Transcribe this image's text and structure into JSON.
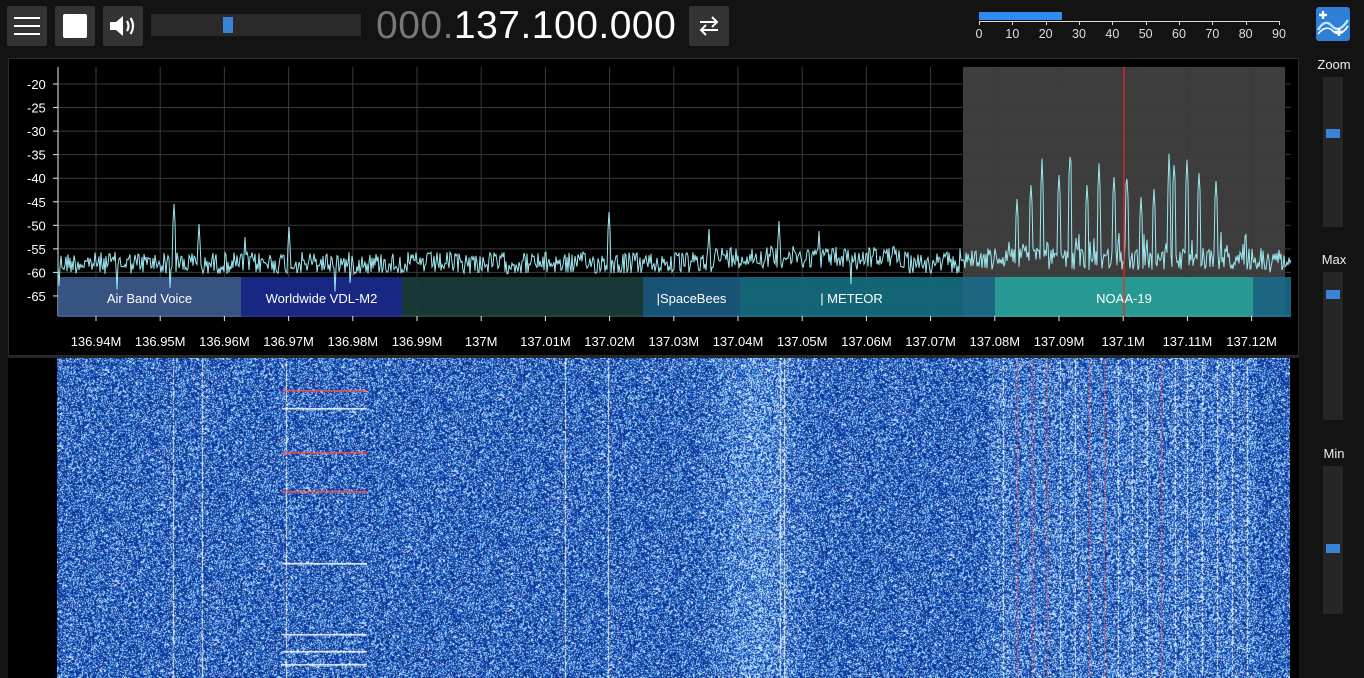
{
  "toolbar": {
    "menu_icon": "hamburger-menu-icon",
    "stop_icon": "stop-square-icon",
    "volume_icon": "speaker-volume-icon",
    "volume_level": 0.36,
    "frequency_leading": "000.",
    "frequency_main": "137.100.000",
    "swap_icon": "swap-arrows-icon",
    "logo_icon": "sdrpp-logo-icon"
  },
  "snr_meter": {
    "value": 26,
    "max": 90,
    "ticks": [
      "0",
      "10",
      "20",
      "30",
      "40",
      "50",
      "60",
      "70",
      "80",
      "90"
    ]
  },
  "fft": {
    "y_ticks": [
      "-20",
      "-25",
      "-30",
      "-35",
      "-40",
      "-45",
      "-50",
      "-55",
      "-60",
      "-65"
    ],
    "x_ticks": [
      "136.94M",
      "136.95M",
      "136.96M",
      "136.97M",
      "136.98M",
      "136.99M",
      "137M",
      "137.01M",
      "137.02M",
      "137.03M",
      "137.04M",
      "137.05M",
      "137.06M",
      "137.07M",
      "137.08M",
      "137.09M",
      "137.1M",
      "137.11M",
      "137.12M"
    ],
    "bands": [
      {
        "label": "Air Band Voice",
        "color": "#3c5a8c"
      },
      {
        "label": "Worldwide VDL-M2",
        "color": "#1a2a8c"
      },
      {
        "label": "",
        "color": "#1a3d3d"
      },
      {
        "label": "|SpaceBees",
        "color": "#1a5a80"
      },
      {
        "label": "| METEOR",
        "color": "#156e80"
      },
      {
        "label": "NOAA-19",
        "color": "#25a099"
      }
    ]
  },
  "sidebar": {
    "zoom_label": "Zoom",
    "zoom_level": 0.37,
    "max_label": "Max",
    "max_level": 0.13,
    "min_label": "Min",
    "min_level": 0.56
  },
  "colors": {
    "accent": "#3b83d6",
    "spectrum_line": "#9de8f0",
    "tuning_line": "#ff2020",
    "vfo_bandwidth": "#3d3d3d"
  }
}
